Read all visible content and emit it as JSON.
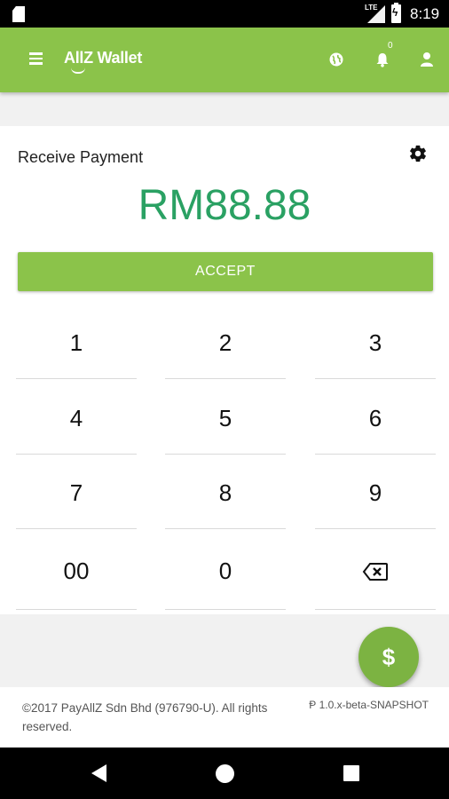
{
  "status_bar": {
    "time": "8:19",
    "network": "LTE"
  },
  "app_bar": {
    "brand": "AllZ Wallet",
    "notification_count": "0"
  },
  "payment": {
    "title": "Receive Payment",
    "amount": "RM88.88",
    "accept_label": "ACCEPT"
  },
  "keypad": {
    "keys": [
      "1",
      "2",
      "3",
      "4",
      "5",
      "6",
      "7",
      "8",
      "9",
      "00",
      "0"
    ]
  },
  "fab": {
    "label": "$"
  },
  "footer": {
    "copyright": "©2017 PayAllZ Sdn Bhd (976790-U). All rights reserved.",
    "version": "Ᵽ 1.0.x-beta-SNAPSHOT"
  },
  "colors": {
    "primary": "#8bc34a",
    "amount": "#2aa163",
    "fab": "#7cb342"
  }
}
